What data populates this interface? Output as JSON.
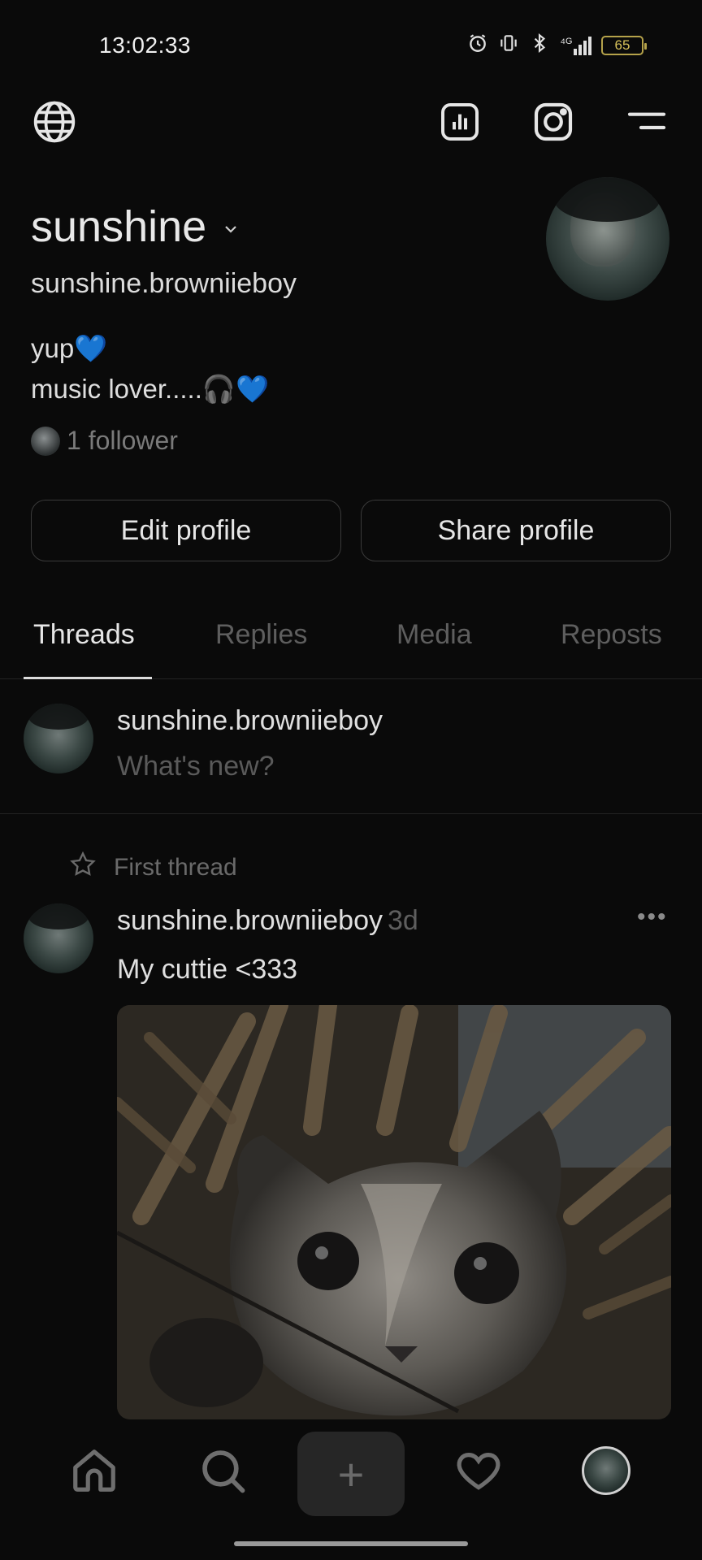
{
  "status_bar": {
    "time": "13:02:33",
    "signal": "⁴ᴳ",
    "battery": "65",
    "icons": [
      "alarm-icon",
      "vibrate-icon",
      "bluetooth-icon",
      "signal-icon",
      "battery-icon"
    ]
  },
  "top_nav": {
    "icons": [
      "globe-icon",
      "insights-icon",
      "instagram-icon",
      "menu-icon"
    ]
  },
  "profile": {
    "name": "sunshine",
    "handle": "sunshine.browniieboy",
    "bio_line1": "yup",
    "bio_line2": "music lover.....",
    "bio_emoji_heart": "💙",
    "bio_emoji_headphones": "🎧",
    "followers": "1 follower"
  },
  "actions": {
    "edit": "Edit profile",
    "share": "Share profile"
  },
  "tabs": [
    {
      "label": "Threads",
      "active": true
    },
    {
      "label": "Replies",
      "active": false
    },
    {
      "label": "Media",
      "active": false
    },
    {
      "label": "Reposts",
      "active": false
    }
  ],
  "composer": {
    "user": "sunshine.browniieboy",
    "prompt": "What's new?"
  },
  "post": {
    "pinned_label": "First thread",
    "user": "sunshine.browniieboy",
    "time": "3d",
    "more": "•••",
    "text": "My cuttie <333"
  },
  "bottom_nav": {
    "plus": "+",
    "items": [
      "home-icon",
      "search-icon",
      "create-icon",
      "activity-heart-icon",
      "profile-avatar"
    ]
  },
  "colors": {
    "background": "#0a0a0a",
    "text": "#e8e8e8",
    "muted": "#5e5e5e",
    "heart_emoji": "#3b7ae0",
    "battery": "#d8c25a"
  }
}
